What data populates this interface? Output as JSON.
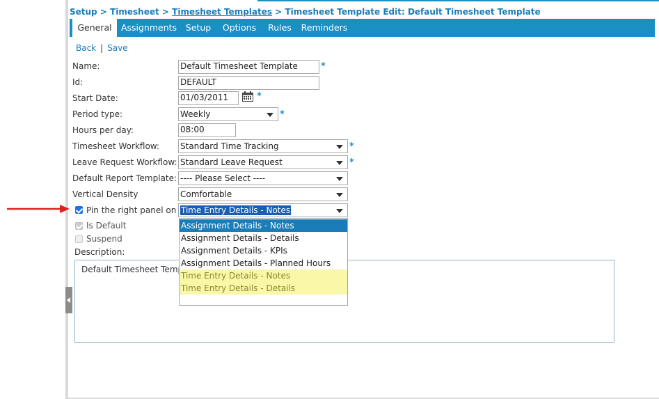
{
  "breadcrumb": {
    "setup": "Setup",
    "sep1": " > ",
    "timesheet": "Timesheet",
    "sep2": " > ",
    "templates": "Timesheet Templates",
    "sep3": " > ",
    "current": "Timesheet Template Edit: Default Timesheet Template"
  },
  "tabs": [
    {
      "label": "General",
      "active": true
    },
    {
      "label": "Assignments"
    },
    {
      "label": "Setup"
    },
    {
      "label": "Options"
    },
    {
      "label": "Rules"
    },
    {
      "label": "Reminders"
    }
  ],
  "actions": {
    "back": "Back",
    "separator": "|",
    "save": "Save"
  },
  "form": {
    "name": {
      "label": "Name:",
      "value": "Default Timesheet Template",
      "required": "*"
    },
    "id": {
      "label": "Id:",
      "value": "DEFAULT"
    },
    "start_date": {
      "label": "Start Date:",
      "value": "01/03/2011",
      "required": "*"
    },
    "period_type": {
      "label": "Period type:",
      "value": "Weekly",
      "required": "*"
    },
    "hours_per_day": {
      "label": "Hours per day:",
      "value": "08:00"
    },
    "timesheet_workflow": {
      "label": "Timesheet Workflow:",
      "value": "Standard Time Tracking",
      "required": "*"
    },
    "leave_request_workflow": {
      "label": "Leave Request Workflow:",
      "value": "Standard Leave Request",
      "required": "*"
    },
    "default_report_template": {
      "label": "Default Report Template:",
      "value": "---- Please Select ----"
    },
    "vertical_density": {
      "label": "Vertical Density",
      "value": "Comfortable"
    },
    "pin_right_panel": {
      "label": "Pin the right panel on",
      "checked": true,
      "value": "Time Entry Details - Notes"
    },
    "is_default": {
      "label": "Is Default",
      "checked": true
    },
    "suspend": {
      "label": "Suspend",
      "checked": false
    },
    "description": {
      "label": "Description:",
      "value": "Default Timesheet Template"
    }
  },
  "dropdown_options": [
    "Assignment Details - Notes",
    "Assignment Details - Details",
    "Assignment Details - KPIs",
    "Assignment Details - Planned Hours",
    "Time Entry Details - Notes",
    "Time Entry Details - Details"
  ],
  "colors": {
    "accent": "#1a8fc4",
    "link": "#1a7db8",
    "highlight": "#fbf7a8",
    "annotation_arrow": "#e02020"
  }
}
